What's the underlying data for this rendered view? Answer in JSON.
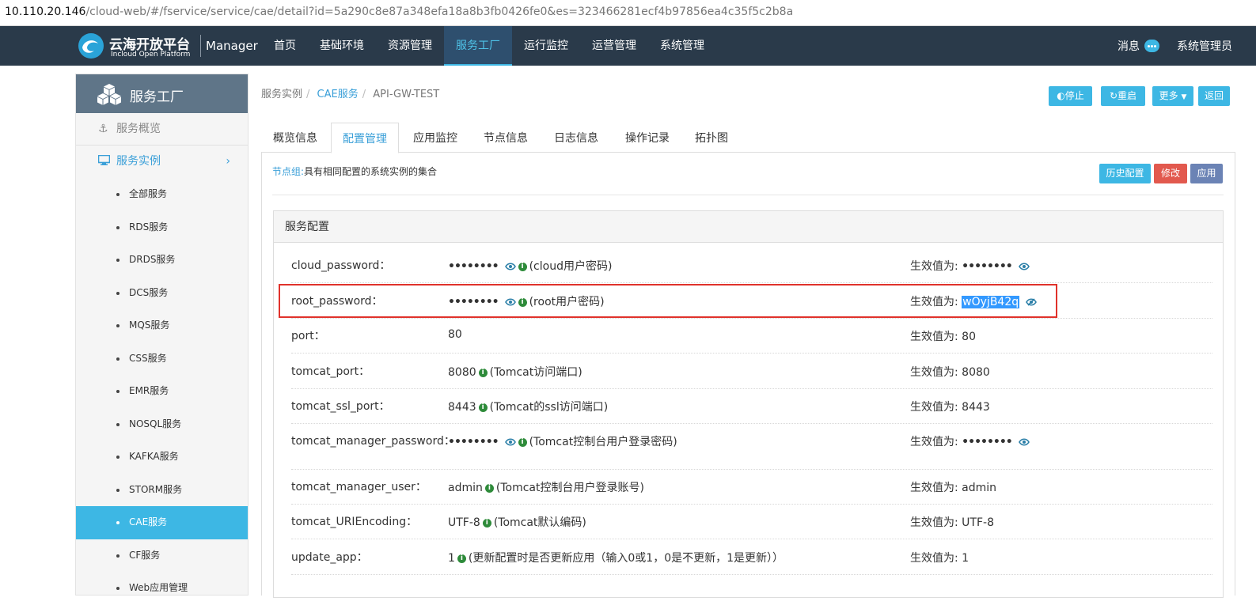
{
  "browser": {
    "url_host": "10.110.20.146",
    "url_rest": "/cloud-web/#/fservice/service/cae/detail?id=5a290c8e87a348efa18a8b3fb0426fe0&es=323466281ecf4b97856ea4c35f5c2b8a"
  },
  "header": {
    "logo_title": "云海开放平台",
    "logo_subtitle": "Incloud Open Platform",
    "brand_suffix": "Manager",
    "nav": [
      "首页",
      "基础环境",
      "资源管理",
      "服务工厂",
      "运行监控",
      "运营管理",
      "系统管理"
    ],
    "active_nav": "服务工厂",
    "messages_label": "消息",
    "user_label": "系统管理员"
  },
  "sidebar": {
    "title": "服务工厂",
    "overview": "服务概览",
    "instances": "服务实例",
    "sub_items": [
      "全部服务",
      "RDS服务",
      "DRDS服务",
      "DCS服务",
      "MQS服务",
      "CSS服务",
      "EMR服务",
      "NOSQL服务",
      "KAFKA服务",
      "STORM服务",
      "CAE服务",
      "CF服务",
      "Web应用管理"
    ],
    "active_sub": "CAE服务"
  },
  "breadcrumb": {
    "items": [
      "服务实例",
      "CAE服务",
      "API-GW-TEST"
    ]
  },
  "actions": {
    "stop": "停止",
    "restart": "重启",
    "more": "更多",
    "back": "返回"
  },
  "tabs": [
    "概览信息",
    "配置管理",
    "应用监控",
    "节点信息",
    "日志信息",
    "操作记录",
    "拓扑图"
  ],
  "active_tab": "配置管理",
  "config": {
    "node_group_key": "节点组:",
    "node_group_desc": "具有相同配置的系统实例的集合",
    "history_btn": "历史配置",
    "modify_btn": "修改",
    "apply_btn": "应用",
    "section_title": "服务配置",
    "effective_prefix": "生效值为: ",
    "rows": [
      {
        "key": "cloud_password：",
        "value": "••••••••",
        "masked": true,
        "desc": "(cloud用户密码)",
        "effective": "••••••••",
        "eff_masked": true
      },
      {
        "key": "root_password：",
        "value": "••••••••",
        "masked": true,
        "desc": "(root用户密码)",
        "effective": "wOyjB42q",
        "eff_masked": false,
        "eff_revealed": true
      },
      {
        "key": "port：",
        "value": "80",
        "masked": false,
        "desc": "",
        "effective": "80"
      },
      {
        "key": "tomcat_port：",
        "value": "8080",
        "masked": false,
        "desc": "(Tomcat访问端口)",
        "effective": "8080"
      },
      {
        "key": "tomcat_ssl_port：",
        "value": "8443",
        "masked": false,
        "desc": "(Tomcat的ssl访问端口)",
        "effective": "8443"
      },
      {
        "key": "tomcat_manager_password：",
        "value": "••••••••",
        "masked": true,
        "desc": "(Tomcat控制台用户登录密码)",
        "effective": "••••••••",
        "eff_masked": true
      },
      {
        "key": "tomcat_manager_user：",
        "value": "admin",
        "masked": false,
        "desc": "(Tomcat控制台用户登录账号)",
        "effective": "admin"
      },
      {
        "key": "tomcat_URIEncoding：",
        "value": "UTF-8",
        "masked": false,
        "desc": "(Tomcat默认编码)",
        "effective": "UTF-8"
      },
      {
        "key": "update_app：",
        "value": "1",
        "masked": false,
        "desc": "(更新配置时是否更新应用（输入0或1，0是不更新，1是更新））",
        "effective": "1"
      }
    ]
  },
  "colors": {
    "nav_bg": "#2a3a4a",
    "accent": "#3db7e4",
    "danger": "#e2594e",
    "highlight_box": "#e0322b"
  }
}
